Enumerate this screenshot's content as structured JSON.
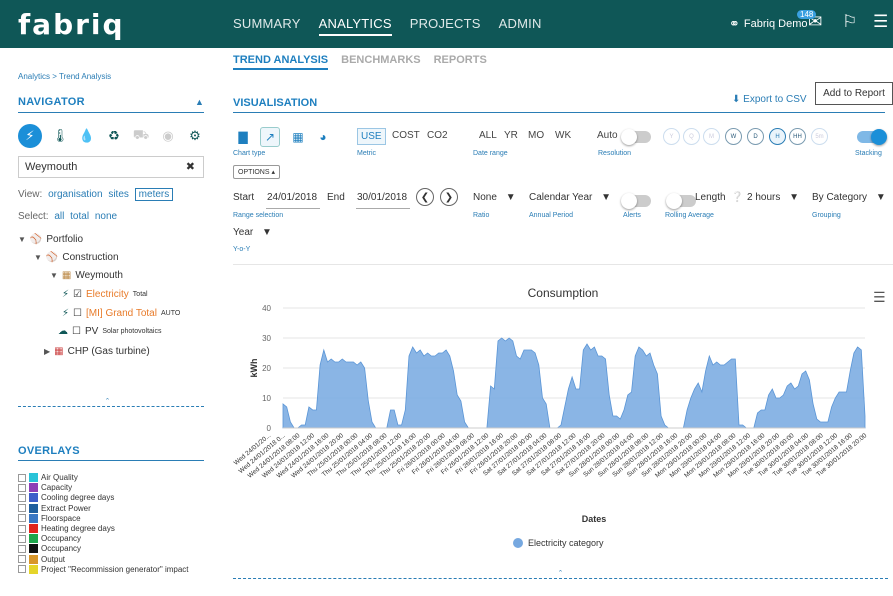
{
  "brand": {
    "logo": "fabriq"
  },
  "topnav": {
    "items": [
      {
        "label": "SUMMARY",
        "active": false
      },
      {
        "label": "ANALYTICS",
        "active": true
      },
      {
        "label": "PROJECTS",
        "active": false
      },
      {
        "label": "ADMIN",
        "active": false
      }
    ]
  },
  "user": {
    "name": "Fabriq Demo",
    "notification_count": "148"
  },
  "left": {
    "breadcrumb": "Analytics > Trend Analysis",
    "navigator_title": "NAVIGATOR",
    "search_value": "Weymouth",
    "view_label": "View:",
    "view_opts": [
      "organisation",
      "sites",
      "meters"
    ],
    "select_label": "Select:",
    "select_opts": [
      "all",
      "total",
      "none"
    ],
    "tree": {
      "portfolio": "Portfolio",
      "construction": "Construction",
      "weymouth": "Weymouth",
      "electricity": "Electricity",
      "electricity_sub": "Total",
      "grand_total": "[MI] Grand Total",
      "grand_total_sub": "AUTO",
      "pv": "PV",
      "pv_sub": "Solar photovoltaics",
      "chp": "CHP (Gas turbine)"
    },
    "overlays_title": "OVERLAYS",
    "overlays": [
      {
        "label": "Air Quality",
        "color": "#29c3d8"
      },
      {
        "label": "Capacity",
        "color": "#8e3fb6"
      },
      {
        "label": "Cooling degree days",
        "color": "#3d5ec9"
      },
      {
        "label": "Extract Power",
        "color": "#1f5f9e"
      },
      {
        "label": "Floorspace",
        "color": "#3a78c4"
      },
      {
        "label": "Heating degree days",
        "color": "#e2261d"
      },
      {
        "label": "Occupancy",
        "color": "#1ea64b"
      },
      {
        "label": "Occupancy",
        "color": "#111111"
      },
      {
        "label": "Output",
        "color": "#d8962a"
      },
      {
        "label": "Project \"Recommission generator\" impact",
        "color": "#e5d52a"
      }
    ]
  },
  "main": {
    "subtabs": [
      {
        "label": "TREND ANALYSIS",
        "active": true
      },
      {
        "label": "BENCHMARKS",
        "active": false
      },
      {
        "label": "REPORTS",
        "active": false
      }
    ],
    "vis_title": "VISUALISATION",
    "export_label": "Export to CSV",
    "add_report_label": "Add to Report",
    "chart_type_label": "Chart type",
    "metric_label": "Metric",
    "metrics": [
      "USE",
      "COST",
      "CO2"
    ],
    "date_range_label": "Date range",
    "date_ranges": [
      "ALL",
      "YR",
      "MO",
      "WK"
    ],
    "auto_label": "Auto",
    "resolution_label": "Resolution",
    "resolutions": [
      "Y",
      "Q",
      "M",
      "W",
      "D",
      "H",
      "HH",
      "5m"
    ],
    "stacking_label": "Stacking",
    "options_label": "OPTIONS",
    "start_label": "Start",
    "start_value": "24/01/2018",
    "end_label": "End",
    "end_value": "30/01/2018",
    "range_selection_label": "Range selection",
    "ratio_value": "None",
    "ratio_label": "Ratio",
    "annual_value": "Calendar Year",
    "annual_label": "Annual Period",
    "alerts_label": "Alerts",
    "length_label": "Length",
    "rolling_value": "2 hours",
    "rolling_label": "Rolling Average",
    "grouping_value": "By Category",
    "grouping_label": "Grouping",
    "yoy_value": "Year",
    "yoy_label": "Y-o-Y"
  },
  "chart_data": {
    "type": "area",
    "title": "Consumption",
    "xlabel": "Dates",
    "ylabel": "kWh",
    "ylim": [
      0,
      40
    ],
    "yticks": [
      0,
      10,
      20,
      30,
      40
    ],
    "grid": true,
    "legend": "bottom",
    "series": [
      {
        "name": "Electricity category",
        "color": "#76a8e0",
        "values": [
          8,
          7,
          2,
          0,
          0,
          1,
          1,
          7,
          6,
          6,
          21,
          26,
          22,
          23,
          22,
          22,
          23,
          22,
          22,
          22,
          21,
          22,
          20,
          9,
          2,
          0,
          0,
          0,
          0,
          6,
          6,
          1,
          1,
          6,
          24,
          27,
          25,
          26,
          24,
          25,
          24,
          24,
          25,
          25,
          26,
          24,
          19,
          11,
          9,
          2,
          0,
          0,
          0,
          0,
          0,
          0,
          14,
          13,
          29,
          30,
          29,
          30,
          29,
          24,
          23,
          26,
          26,
          26,
          25,
          21,
          10,
          8,
          0,
          0,
          0,
          1,
          7,
          13,
          17,
          13,
          13,
          26,
          28,
          26,
          27,
          24,
          24,
          23,
          11,
          4,
          4,
          3,
          6,
          11,
          12,
          24,
          27,
          26,
          24,
          25,
          21,
          18,
          4,
          1,
          0,
          0,
          0,
          0,
          0,
          6,
          10,
          13,
          15,
          12,
          19,
          24,
          21,
          22,
          21,
          21,
          22,
          23,
          23,
          1,
          1,
          0,
          0,
          0,
          5,
          6,
          6,
          11,
          13,
          10,
          10,
          11,
          14,
          15,
          13,
          14,
          18,
          19,
          16,
          8,
          3,
          2,
          2,
          2,
          7,
          10,
          12,
          12,
          12,
          19,
          25,
          27,
          26,
          4
        ]
      }
    ],
    "x_tick_labels": [
      "Wed 24/01/20...",
      "Wed 24/01/2018 0...",
      "Wed 24/01/2018 08:00",
      "Wed 24/01/2018 12:00",
      "Wed 24/01/2018 16:00",
      "Wed 24/01/2018 20:00",
      "Thu 25/01/2018 00:00",
      "Thu 25/01/2018 04:00",
      "Thu 25/01/2018 08:00",
      "Thu 25/01/2018 12:00",
      "Thu 25/01/2018 16:00",
      "Thu 25/01/2018 20:00",
      "Fri 26/01/2018 00:00",
      "Fri 26/01/2018 04:00",
      "Fri 26/01/2018 08:00",
      "Fri 26/01/2018 12:00",
      "Fri 26/01/2018 16:00",
      "Fri 26/01/2018 20:00",
      "Sat 27/01/2018 00:00",
      "Sat 27/01/2018 04:00",
      "Sat 27/01/2018 08:00",
      "Sat 27/01/2018 12:00",
      "Sat 27/01/2018 16:00",
      "Sat 27/01/2018 20:00",
      "Sun 28/01/2018 00:00",
      "Sun 28/01/2018 04:00",
      "Sun 28/01/2018 08:00",
      "Sun 28/01/2018 12:00",
      "Sun 28/01/2018 16:00",
      "Sun 28/01/2018 20:00",
      "Mon 29/01/2018 00:00",
      "Mon 29/01/2018 04:00",
      "Mon 29/01/2018 08:00",
      "Mon 29/01/2018 12:00",
      "Mon 29/01/2018 16:00",
      "Mon 29/01/2018 20:00",
      "Tue 30/01/2018 00:00",
      "Tue 30/01/2018 04:00",
      "Tue 30/01/2018 08:00",
      "Tue 30/01/2018 12:00",
      "Tue 30/01/2018 16:00",
      "Tue 30/01/2018 20:00"
    ]
  }
}
